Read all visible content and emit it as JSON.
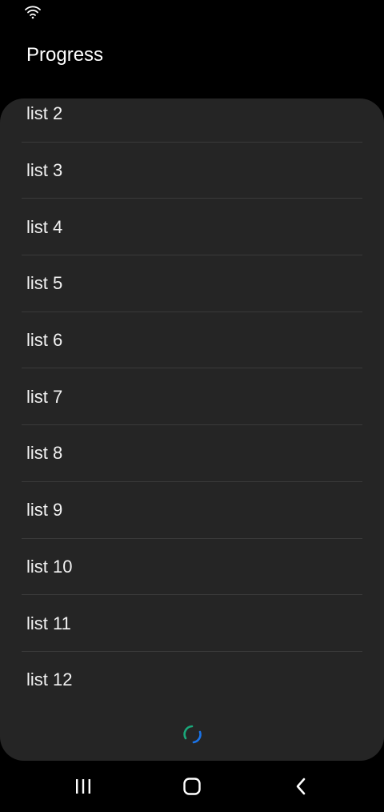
{
  "app": {
    "title": "Progress"
  },
  "list": {
    "items": [
      {
        "label": "list 2"
      },
      {
        "label": "list 3"
      },
      {
        "label": "list 4"
      },
      {
        "label": "list 5"
      },
      {
        "label": "list 6"
      },
      {
        "label": "list 7"
      },
      {
        "label": "list 8"
      },
      {
        "label": "list 9"
      },
      {
        "label": "list 10"
      },
      {
        "label": "list 11"
      },
      {
        "label": "list 12"
      }
    ]
  },
  "icons": {
    "status": "wifi-icon",
    "loading": "progress-spinner-icon",
    "recents": "recent-apps-icon",
    "home": "home-icon",
    "back": "back-icon"
  },
  "colors": {
    "background": "#000000",
    "card": "#252525",
    "divider": "#3a3a3a",
    "spinner_primary": "#1a73e8",
    "spinner_secondary": "#1aa87a"
  }
}
